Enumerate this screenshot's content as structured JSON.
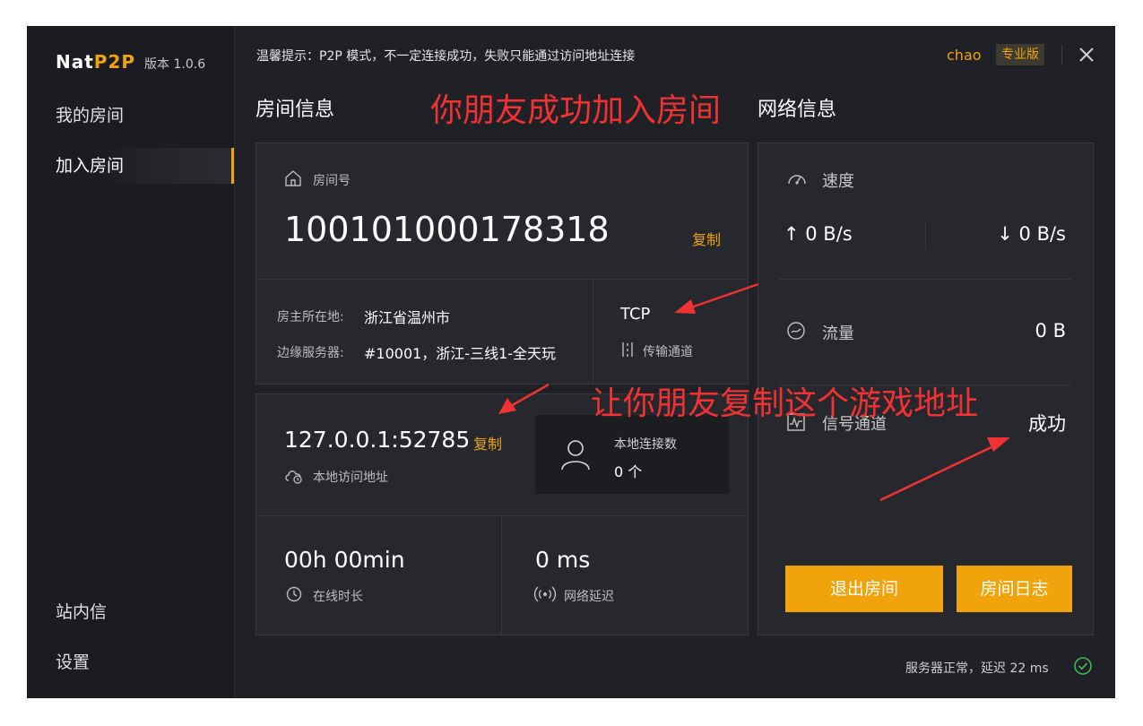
{
  "app": {
    "name_part1": "Nat",
    "name_part2": "P2P",
    "version": "版本 1.0.6",
    "accent": "#f0a30a",
    "annotation_color": "#f03232"
  },
  "sidebar": {
    "items": [
      {
        "label": "我的房间"
      },
      {
        "label": "加入房间",
        "active": true
      },
      {
        "label": "站内信"
      },
      {
        "label": "设置"
      }
    ]
  },
  "header": {
    "tip": "温馨提示：P2P 模式，不一定连接成功，失败只能通过访问地址连接",
    "username": "chao",
    "edition": "专业版",
    "close_icon": "close-icon"
  },
  "room": {
    "section_title": "房间信息",
    "room_number_label": "房间号",
    "room_number": "100101000178318",
    "copy_label": "复制",
    "owner_location_label": "房主所在地:",
    "owner_location": "浙江省温州市",
    "edge_server_label": "边缘服务器:",
    "edge_server": "#10001，浙江-三线1-全天玩",
    "protocol": "TCP",
    "protocol_label": "传输通道",
    "local_address": "127.0.0.1:52785",
    "local_address_copy": "复制",
    "local_address_label": "本地访问地址",
    "local_connections_label": "本地连接数",
    "local_connections": "0 个",
    "online_time": "00h 00min",
    "online_time_label": "在线时长",
    "latency": "0 ms",
    "latency_label": "网络延迟"
  },
  "network": {
    "section_title": "网络信息",
    "speed_label": "速度",
    "upload": "↑ 0 B/s",
    "download": "↓ 0 B/s",
    "traffic_label": "流量",
    "traffic": "0 B",
    "signal_label": "信号通道",
    "signal_status": "成功",
    "exit_button": "退出房间",
    "log_button": "房间日志"
  },
  "footer": {
    "status": "服务器正常，延迟 22 ms"
  },
  "annotations": {
    "top": "你朋友成功加入房间",
    "middle": "让你朋友复制这个游戏地址"
  }
}
